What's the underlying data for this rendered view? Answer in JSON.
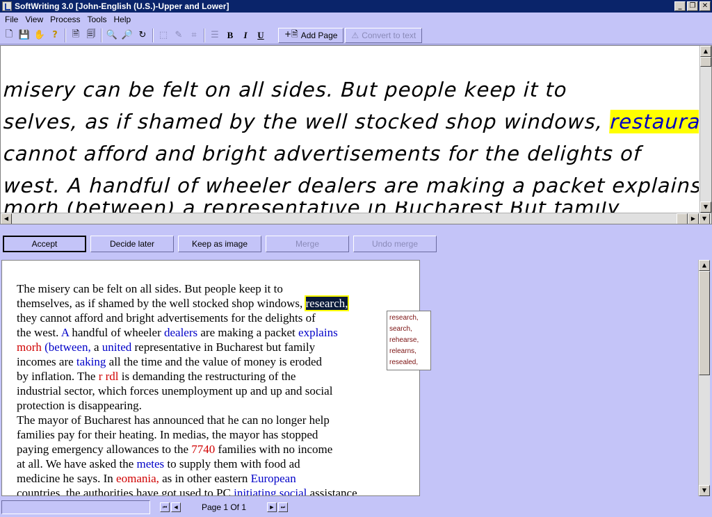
{
  "window": {
    "title": "SoftWriting 3.0 [John-English (U.S.)-Upper and Lower]"
  },
  "menu": [
    {
      "label": "File"
    },
    {
      "label": "View"
    },
    {
      "label": "Process"
    },
    {
      "label": "Tools"
    },
    {
      "label": "Help"
    }
  ],
  "toolbar": {
    "add_page": "Add Page",
    "convert": "Convert to text",
    "bold": "B",
    "italic": "I",
    "underline": "U"
  },
  "handwriting": {
    "lines": [
      "misery can be felt on all sides. But people keep it  to",
      "selves, as if shamed by the well stocked shop windows,",
      "cannot afford and bright advertisements  for the delights of",
      "west. A handful of wheeler dealers are making a packet explains"
    ],
    "highlight": "restauran",
    "partial_line": "morh (between) a representative in Bucharest  But family"
  },
  "actions": {
    "accept": "Accept",
    "decide_later": "Decide later",
    "keep_as_image": "Keep as image",
    "merge": "Merge",
    "undo_merge": "Undo merge"
  },
  "recognized": {
    "l1": "The misery can be felt on all sides. But people keep it to",
    "l2a": "themselves, as if shamed by the well stocked shop windows, ",
    "l2sel": "research,",
    "l3": "they cannot afford and bright advertisements for the delights of",
    "l4a": "the west. ",
    "l4b": "A",
    "l4c": " handful of wheeler ",
    "l4d": "dealers",
    "l4e": " are making a packet ",
    "l4f": "explains",
    "l5a": "morh",
    "l5b": " (between,",
    "l5c": " a ",
    "l5d": "united",
    "l5e": " representative in Bucharest but family",
    "l6a": "incomes are ",
    "l6b": "taking",
    "l6c": " all the time and the value of money is eroded",
    "l7a": "by inflation. The ",
    "l7b": "r rdl",
    "l7c": " is demanding the restructuring of the",
    "l8": "industrial sector, which forces unemployment up and up and social",
    "l9": "protection is disappearing.",
    "l10": "The mayor of Bucharest has announced that he can no longer help",
    "l11": "families pay for their heating. In medias, the mayor has stopped",
    "l12a": "paying emergency allowances to the ",
    "l12b": "7740",
    "l12c": " families with no income",
    "l13a": "at all. We have asked the ",
    "l13b": "metes",
    "l13c": " to supply them with food ad",
    "l14a": "medicine he says. In ",
    "l14b": "eomania,",
    "l14c": " as in other eastern ",
    "l14d": "European",
    "l15a": "countries, the authorities have got used to PC ",
    "l15b": "initiating social",
    "l15c": " assistance"
  },
  "suggestions": [
    "research,",
    "search,",
    "rehearse,",
    "relearns,",
    "resealed,"
  ],
  "status": {
    "page": "Page 1 Of 1"
  }
}
